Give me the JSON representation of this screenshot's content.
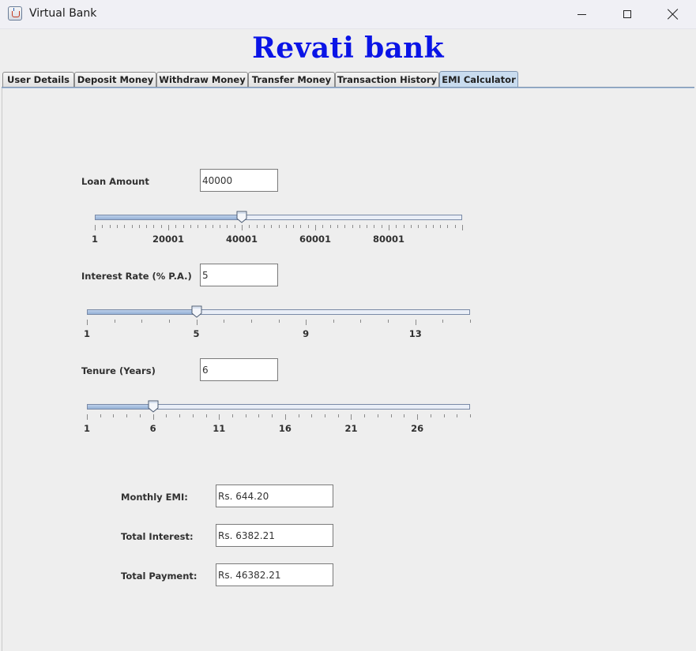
{
  "window": {
    "title": "Virtual Bank",
    "icon": "java-cup-icon"
  },
  "bank_name": "Revati bank",
  "tabs": [
    {
      "label": "User Details",
      "active": false
    },
    {
      "label": "Deposit Money",
      "active": false
    },
    {
      "label": "Withdraw Money",
      "active": false
    },
    {
      "label": "Transfer Money",
      "active": false
    },
    {
      "label": "Transaction History",
      "active": false
    },
    {
      "label": "EMI Calculator",
      "active": true
    }
  ],
  "emi": {
    "loan_amount": {
      "label": "Loan Amount",
      "value": "40000",
      "slider": {
        "min": 1,
        "max": 100001,
        "value": 40000,
        "tick_labels": [
          "1",
          "20001",
          "40001",
          "60001",
          "80001"
        ],
        "major_step": 20000,
        "minor_step": 2000
      }
    },
    "interest_rate": {
      "label": "Interest Rate (% P.A.)",
      "value": "5",
      "slider": {
        "min": 1,
        "max": 15,
        "value": 5,
        "tick_labels": [
          "1",
          "5",
          "9",
          "13"
        ],
        "major_step": 4,
        "minor_step": 1
      }
    },
    "tenure": {
      "label": "Tenure (Years)",
      "value": "6",
      "slider": {
        "min": 1,
        "max": 30,
        "value": 6,
        "tick_labels": [
          "1",
          "6",
          "11",
          "16",
          "21",
          "26"
        ],
        "major_step": 5,
        "minor_step": 1
      }
    },
    "results": {
      "monthly_emi": {
        "label": "Monthly EMI:",
        "value": "Rs. 644.20"
      },
      "total_interest": {
        "label": "Total Interest:",
        "value": "Rs. 6382.21"
      },
      "total_payment": {
        "label": "Total Payment:",
        "value": "Rs. 46382.21"
      }
    }
  },
  "colors": {
    "bank_title": "#0a14e6",
    "active_tab": "#c9dcef",
    "slider_fill": "#94b0d6"
  }
}
